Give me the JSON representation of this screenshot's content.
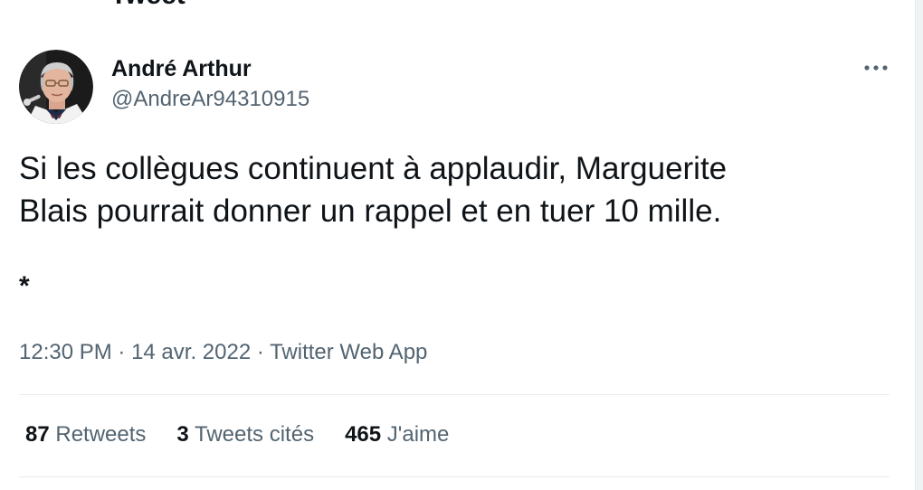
{
  "header": {
    "title_cut": "Tweet"
  },
  "author": {
    "display_name": "André Arthur",
    "handle": "@AndreAr94310915"
  },
  "tweet": {
    "line1": "Si les collègues continuent à applaudir, Marguerite",
    "line2": "Blais pourrait donner un rappel et en tuer 10 mille.",
    "extra": "*"
  },
  "meta": {
    "time": "12:30 PM",
    "sep1": " · ",
    "date": "14 avr. 2022",
    "sep2": " · ",
    "source": "Twitter Web App"
  },
  "stats": {
    "retweets_count": "87",
    "retweets_label": "Retweets",
    "quotes_count": "3",
    "quotes_label": "Tweets cités",
    "likes_count": "465",
    "likes_label": "J'aime"
  },
  "icons": {
    "more": "more-horizontal-icon",
    "avatar": "profile-photo"
  },
  "colors": {
    "text_primary": "#0f1419",
    "text_secondary": "#536471",
    "divider": "#e7ecf0"
  }
}
